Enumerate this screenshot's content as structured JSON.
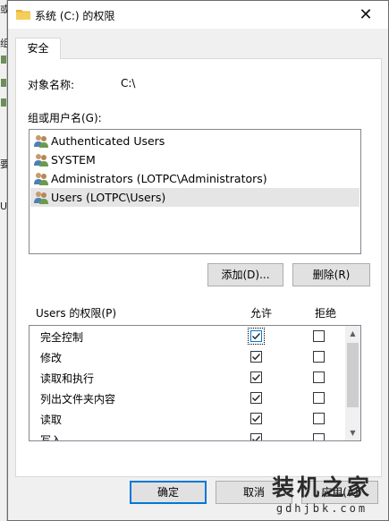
{
  "background_window": {
    "chars": [
      "或",
      "组",
      "要",
      "Us"
    ]
  },
  "window": {
    "title": "系统 (C:) 的权限",
    "close_glyph": "✕"
  },
  "tabs": [
    {
      "label": "安全",
      "active": true
    }
  ],
  "object": {
    "label": "对象名称:",
    "value": "C:\\"
  },
  "groups": {
    "label": "组或用户名(G):",
    "items": [
      {
        "name": "Authenticated Users",
        "selected": false
      },
      {
        "name": "SYSTEM",
        "selected": false
      },
      {
        "name": "Administrators (LOTPC\\Administrators)",
        "selected": false
      },
      {
        "name": "Users (LOTPC\\Users)",
        "selected": true
      }
    ]
  },
  "buttons": {
    "add": "添加(D)...",
    "remove": "删除(R)",
    "ok": "确定",
    "cancel": "取消",
    "apply": "应用(A)"
  },
  "permissions": {
    "label": "Users 的权限(P)",
    "allow_header": "允许",
    "deny_header": "拒绝",
    "rows": [
      {
        "name": "完全控制",
        "allow": true,
        "deny": false
      },
      {
        "name": "修改",
        "allow": true,
        "deny": false
      },
      {
        "name": "读取和执行",
        "allow": true,
        "deny": false
      },
      {
        "name": "列出文件夹内容",
        "allow": true,
        "deny": false
      },
      {
        "name": "读取",
        "allow": true,
        "deny": false
      },
      {
        "name": "写入",
        "allow": true,
        "deny": false
      }
    ]
  },
  "watermark": {
    "main": "装机之家",
    "sub": "gdhjbk.com"
  },
  "colors": {
    "accent": "#0078d7",
    "selection": "#e5e5e5",
    "panel": "#f0f0f0"
  }
}
